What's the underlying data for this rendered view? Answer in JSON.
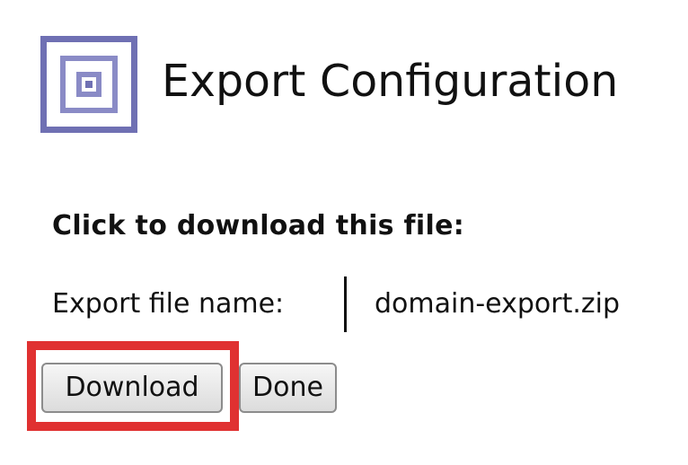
{
  "header": {
    "title": "Export Configuration",
    "logo_icon": "nested-square-logo-icon",
    "logo_color": "#6f70b3"
  },
  "content": {
    "instruction": "Click to download this file:",
    "file_name_label": "Export file name:",
    "file_name_value": "domain-export.zip"
  },
  "actions": {
    "download_label": "Download",
    "done_label": "Done"
  },
  "annotation": {
    "highlight_color": "#e03131",
    "highlighted_control": "Download"
  }
}
